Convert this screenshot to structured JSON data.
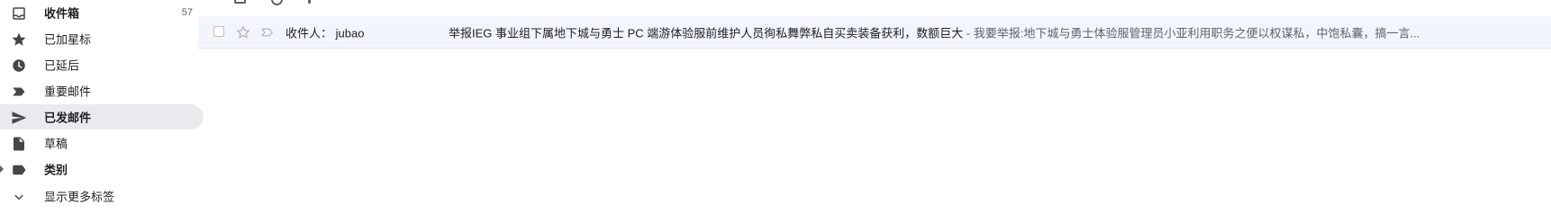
{
  "sidebar": {
    "items": [
      {
        "label": "收件箱",
        "count": "57",
        "icon": "inbox-icon",
        "bold": true,
        "active": false
      },
      {
        "label": "已加星标",
        "count": "",
        "icon": "star-icon",
        "bold": false,
        "active": false
      },
      {
        "label": "已延后",
        "count": "",
        "icon": "clock-icon",
        "bold": false,
        "active": false
      },
      {
        "label": "重要邮件",
        "count": "",
        "icon": "important-label-icon",
        "bold": false,
        "active": false
      },
      {
        "label": "已发邮件",
        "count": "",
        "icon": "send-icon",
        "bold": true,
        "active": true
      },
      {
        "label": "草稿",
        "count": "",
        "icon": "draft-icon",
        "bold": false,
        "active": false
      },
      {
        "label": "类别",
        "count": "",
        "icon": "label-icon",
        "bold": true,
        "active": false
      },
      {
        "label": "显示更多标签",
        "count": "",
        "icon": "chevron-down-icon",
        "bold": false,
        "active": false
      }
    ]
  },
  "message_list": {
    "rows": [
      {
        "sender": "收件人： jubao",
        "subject": "举报IEG 事业组下属地下城与勇士 PC 端游体验服前维护人员徇私舞弊私自买卖装备获利，数额巨大",
        "snippet": " - 我要举报:地下城与勇士体验服管理员小亚利用职务之便以权谋私，中饱私囊，搞一言...",
        "starred": false,
        "selected": false
      }
    ]
  },
  "colors": {
    "active_nav_bg": "#e8eaed",
    "row_bg": "#f2f6fc",
    "icon_gray": "#5f6368",
    "text": "#202124"
  }
}
